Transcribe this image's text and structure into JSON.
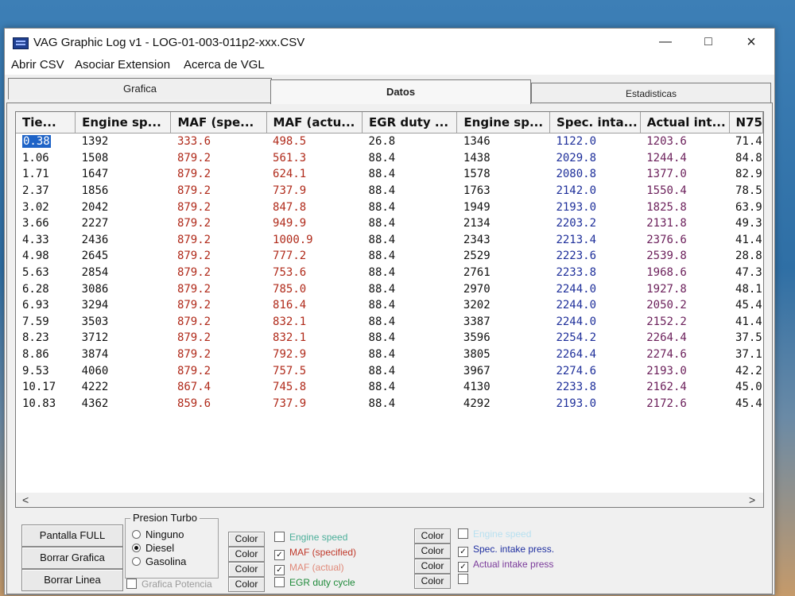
{
  "window": {
    "title": "VAG Graphic Log  v1 -  LOG-01-003-011p2-xxx.CSV"
  },
  "menu": [
    "Abrir CSV",
    "Asociar Extension",
    "Acerca de VGL"
  ],
  "tabs": [
    "Grafica",
    "Datos",
    "Estadisticas"
  ],
  "table": {
    "columns": [
      "Tie...",
      "Engine sp...",
      "MAF (spe...",
      "MAF (actu...",
      "EGR duty ...",
      "Engine sp...",
      "Spec. inta...",
      "Actual int...",
      "N75"
    ],
    "rows": [
      [
        "0.38",
        "1392",
        "333.6",
        "498.5",
        "26.8",
        "1346",
        "1122.0",
        "1203.6",
        "71.4"
      ],
      [
        "1.06",
        "1508",
        "879.2",
        "561.3",
        "88.4",
        "1438",
        "2029.8",
        "1244.4",
        "84.8"
      ],
      [
        "1.71",
        "1647",
        "879.2",
        "624.1",
        "88.4",
        "1578",
        "2080.8",
        "1377.0",
        "82.9"
      ],
      [
        "2.37",
        "1856",
        "879.2",
        "737.9",
        "88.4",
        "1763",
        "2142.0",
        "1550.4",
        "78.5"
      ],
      [
        "3.02",
        "2042",
        "879.2",
        "847.8",
        "88.4",
        "1949",
        "2193.0",
        "1825.8",
        "63.9"
      ],
      [
        "3.66",
        "2227",
        "879.2",
        "949.9",
        "88.4",
        "2134",
        "2203.2",
        "2131.8",
        "49.3"
      ],
      [
        "4.33",
        "2436",
        "879.2",
        "1000.9",
        "88.4",
        "2343",
        "2213.4",
        "2376.6",
        "41.4"
      ],
      [
        "4.98",
        "2645",
        "879.2",
        "777.2",
        "88.4",
        "2529",
        "2223.6",
        "2539.8",
        "28.8"
      ],
      [
        "5.63",
        "2854",
        "879.2",
        "753.6",
        "88.4",
        "2761",
        "2233.8",
        "1968.6",
        "47.3"
      ],
      [
        "6.28",
        "3086",
        "879.2",
        "785.0",
        "88.4",
        "2970",
        "2244.0",
        "1927.8",
        "48.1"
      ],
      [
        "6.93",
        "3294",
        "879.2",
        "816.4",
        "88.4",
        "3202",
        "2244.0",
        "2050.2",
        "45.4"
      ],
      [
        "7.59",
        "3503",
        "879.2",
        "832.1",
        "88.4",
        "3387",
        "2244.0",
        "2152.2",
        "41.4"
      ],
      [
        "8.23",
        "3712",
        "879.2",
        "832.1",
        "88.4",
        "3596",
        "2254.2",
        "2264.4",
        "37.5"
      ],
      [
        "8.86",
        "3874",
        "879.2",
        "792.9",
        "88.4",
        "3805",
        "2264.4",
        "2274.6",
        "37.1"
      ],
      [
        "9.53",
        "4060",
        "879.2",
        "757.5",
        "88.4",
        "3967",
        "2274.6",
        "2193.0",
        "42.2"
      ],
      [
        "10.17",
        "4222",
        "867.4",
        "745.8",
        "88.4",
        "4130",
        "2233.8",
        "2162.4",
        "45.0"
      ],
      [
        "10.83",
        "4362",
        "859.6",
        "737.9",
        "88.4",
        "4292",
        "2193.0",
        "2172.6",
        "45.4"
      ]
    ]
  },
  "scroll": {
    "left": "<",
    "right": ">"
  },
  "buttons": {
    "full": "Pantalla FULL",
    "clear_graph": "Borrar Grafica",
    "clear_line": "Borrar Linea",
    "color": "Color"
  },
  "presion": {
    "legend": "Presion Turbo",
    "options": [
      "Ninguno",
      "Diesel",
      "Gasolina"
    ],
    "selected": "Diesel"
  },
  "grafica_potencia": "Grafica Potencia",
  "series_group1": [
    {
      "label": "Engine speed",
      "checked": false,
      "color": "#4caf9a"
    },
    {
      "label": "MAF (specified)",
      "checked": true,
      "color": "#c0392b"
    },
    {
      "label": "MAF (actual)",
      "checked": true,
      "color": "#e08a7a"
    },
    {
      "label": "EGR duty cycle",
      "checked": false,
      "color": "#1f8a3a"
    }
  ],
  "series_group2": [
    {
      "label": "Engine speed",
      "checked": false,
      "color": "#b8e0f0"
    },
    {
      "label": "Spec. intake press.",
      "checked": true,
      "color": "#1f2fa0"
    },
    {
      "label": "Actual intake press",
      "checked": true,
      "color": "#7a3a9a"
    },
    {
      "label": "",
      "checked": false,
      "color": "#111111"
    }
  ],
  "colors": {
    "col_black": "#111111",
    "col_red": "#b02a1a",
    "col_blue": "#1e2f9a",
    "col_purple": "#6b1f5a",
    "selection": "#1e63c7"
  }
}
